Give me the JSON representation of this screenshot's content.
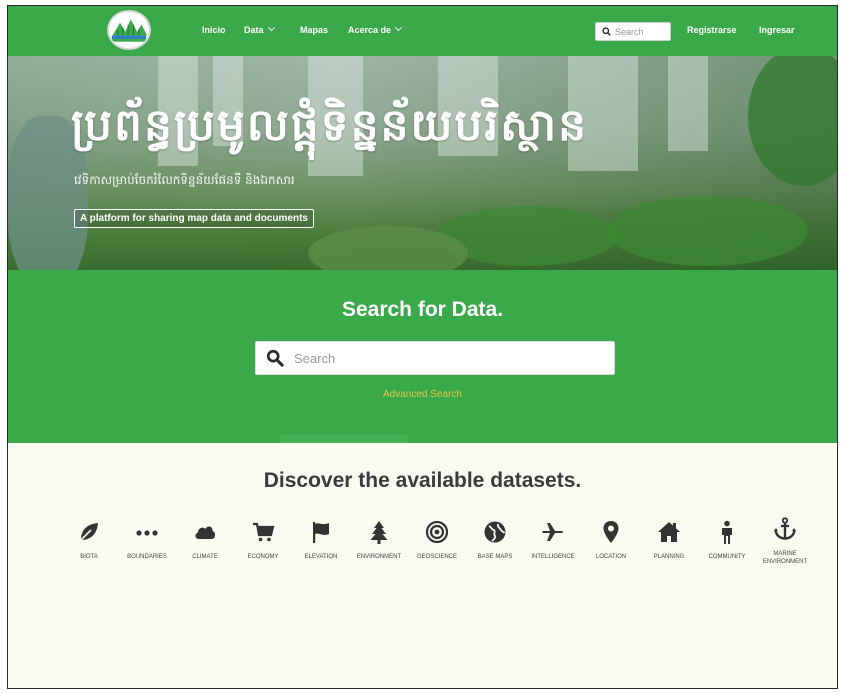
{
  "navbar": {
    "links": [
      "Inicio",
      "Data",
      "Mapas",
      "Acerca de"
    ],
    "search_placeholder": "Search",
    "register": "Registrarse",
    "login": "Ingresar"
  },
  "hero": {
    "title": "ប្រព័ន្ធប្រមូលផ្តុំទិន្នន័យបរិស្ថាន",
    "subtitle": "វេទិកាសម្រាប់ចែករំលែកទិន្នន័យផែនទី និងឯកសារ",
    "tagline": "A platform for sharing map data and documents"
  },
  "search": {
    "title": "Search for Data.",
    "placeholder": "Search",
    "advanced": "Advanced Search"
  },
  "discover": {
    "title": "Discover the available datasets.",
    "categories": [
      {
        "label": "BIOTA",
        "icon": "leaf-icon"
      },
      {
        "label": "BOUNDARIES",
        "icon": "dots-icon"
      },
      {
        "label": "CLIMATE",
        "icon": "cloud-icon"
      },
      {
        "label": "ECONOMY",
        "icon": "cart-icon"
      },
      {
        "label": "ELEVATION",
        "icon": "flag-icon"
      },
      {
        "label": "ENVIRONMENT",
        "icon": "tree-icon"
      },
      {
        "label": "GEOSCIENCE",
        "icon": "bullseye-icon"
      },
      {
        "label": "BASE MAPS",
        "icon": "globe-icon"
      },
      {
        "label": "INTELLIGENCE",
        "icon": "plane-icon"
      },
      {
        "label": "LOCATION",
        "icon": "map-pin-icon"
      },
      {
        "label": "PLANNING",
        "icon": "home-icon"
      },
      {
        "label": "COMMUNITY",
        "icon": "person-icon"
      },
      {
        "label": "MARINE ENVIRONMENT",
        "icon": "anchor-icon"
      }
    ]
  },
  "colors": {
    "primary_green": "#3aa94a",
    "page_background": "#fbfaf1",
    "advanced_link": "#e2c74a",
    "heading_text": "#3b3b3b"
  }
}
